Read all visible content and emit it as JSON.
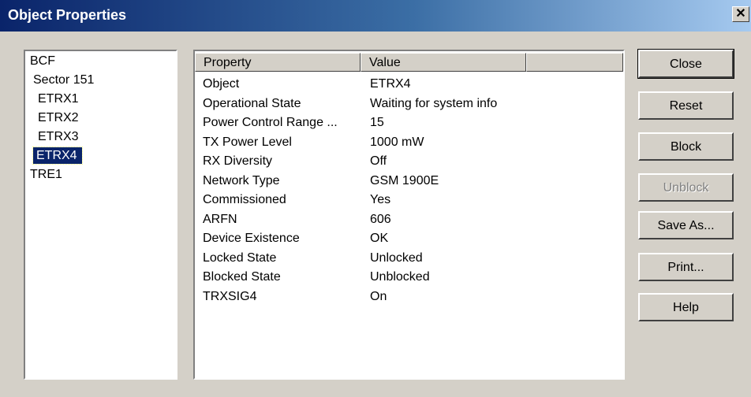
{
  "window": {
    "title": "Object Properties",
    "close_glyph": "✕"
  },
  "tree": {
    "items": [
      {
        "label": "BCF",
        "level": 0,
        "selected": false
      },
      {
        "label": "Sector 151",
        "level": 1,
        "selected": false
      },
      {
        "label": "ETRX1",
        "level": 2,
        "selected": false
      },
      {
        "label": "ETRX2",
        "level": 2,
        "selected": false
      },
      {
        "label": "ETRX3",
        "level": 2,
        "selected": false
      },
      {
        "label": "ETRX4",
        "level": 2,
        "selected": true
      },
      {
        "label": "TRE1",
        "level": 0,
        "selected": false
      }
    ]
  },
  "table": {
    "columns": [
      "Property",
      "Value"
    ],
    "rows": [
      {
        "property": "Object",
        "value": "ETRX4"
      },
      {
        "property": "Operational State",
        "value": "Waiting for system info"
      },
      {
        "property": "Power Control Range ...",
        "value": "15"
      },
      {
        "property": "TX Power Level",
        "value": "1000 mW"
      },
      {
        "property": "RX Diversity",
        "value": "Off"
      },
      {
        "property": "Network Type",
        "value": "GSM 1900E"
      },
      {
        "property": "Commissioned",
        "value": "Yes"
      },
      {
        "property": "ARFN",
        "value": "606"
      },
      {
        "property": "Device Existence",
        "value": "OK"
      },
      {
        "property": "Locked State",
        "value": "Unlocked"
      },
      {
        "property": "Blocked State",
        "value": "Unblocked"
      },
      {
        "property": "TRXSIG4",
        "value": "On"
      }
    ]
  },
  "buttons": {
    "close": "Close",
    "reset": "Reset",
    "block": "Block",
    "unblock": "Unblock",
    "save_as": "Save As...",
    "print": "Print...",
    "help": "Help"
  }
}
